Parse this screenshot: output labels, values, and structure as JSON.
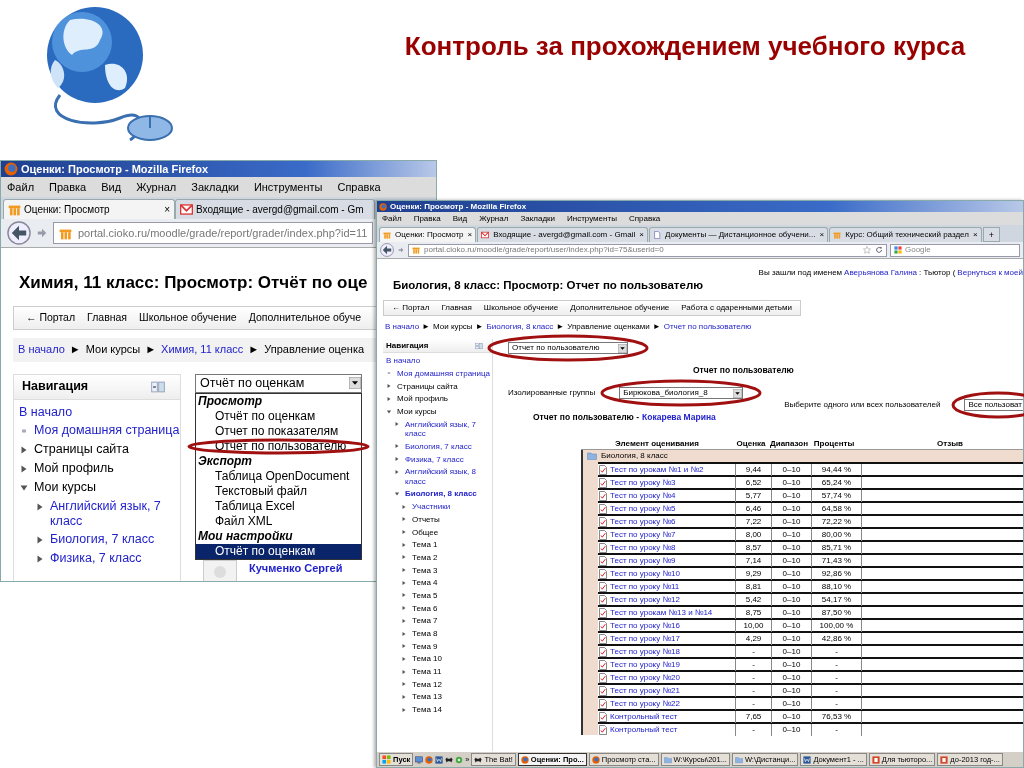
{
  "slide": {
    "title": "Контроль за прохождением учебного курса"
  },
  "window_1": {
    "title": "Оценки: Просмотр - Mozilla Firefox",
    "menu": [
      "Файл",
      "Правка",
      "Вид",
      "Журнал",
      "Закладки",
      "Инструменты",
      "Справка"
    ],
    "tabs": [
      {
        "label": "Оценки: Просмотр",
        "selected": true,
        "close": "×"
      },
      {
        "label": "Входящие - avergd@gmail.com - Gm",
        "selected": false
      }
    ],
    "address": "portal.cioko.ru/moodle/grade/report/grader/index.php?id=11",
    "heading": "Химия, 11 класс: Просмотр: Отчёт по оце",
    "nav_links": [
      "← Портал",
      "Главная",
      "Школьное обучение",
      "Дополнительное обуче"
    ],
    "breadcrumb": {
      "separator": "►",
      "items": [
        {
          "text": "В начало",
          "link": true
        },
        {
          "text": "Мои курсы",
          "link": false
        },
        {
          "text": "Химия, 11 класс",
          "link": true
        },
        {
          "text": "Управление оценка",
          "link": false
        }
      ]
    },
    "navigation": {
      "title": "Навигация",
      "items": [
        {
          "text": "В начало",
          "kind": "plain",
          "link": true
        },
        {
          "text": "Моя домашняя страница",
          "kind": "page",
          "link": true
        },
        {
          "text": "Страницы сайта",
          "kind": "node",
          "link": false,
          "expanded": false
        },
        {
          "text": "Мой профиль",
          "kind": "node",
          "link": false,
          "expanded": false
        },
        {
          "text": "Мои курсы",
          "kind": "node",
          "link": false,
          "expanded": true,
          "children": [
            {
              "text": "Английский язык, 7 класс",
              "kind": "node",
              "link": true,
              "expanded": false
            },
            {
              "text": "Биология, 7 класс",
              "kind": "node",
              "link": true,
              "expanded": false
            },
            {
              "text": "Физика, 7 класс",
              "kind": "node",
              "link": true,
              "expanded": false
            }
          ]
        }
      ]
    },
    "report_select": {
      "value": "Отчёт по оценкам"
    },
    "dropdown": [
      {
        "label": "Просмотр",
        "options": [
          {
            "label": "Отчёт по оценкам",
            "selected": false
          },
          {
            "label": "Отчет по показателям",
            "selected": false
          },
          {
            "label": "Отчет по пользователю",
            "selected": false
          }
        ]
      },
      {
        "label": "Экспорт",
        "options": [
          {
            "label": "Таблица OpenDocument",
            "selected": false
          },
          {
            "label": "Текстовый файл",
            "selected": false
          },
          {
            "label": "Таблица Excel",
            "selected": false
          },
          {
            "label": "Файл XML",
            "selected": false
          }
        ]
      },
      {
        "label": "Мои настройки",
        "options": [
          {
            "label": "Отчёт по оценкам",
            "selected": true
          }
        ]
      }
    ],
    "user_name": "Кучменко Сергей"
  },
  "window_2": {
    "title": "Оценки: Просмотр - Mozilla Firefox",
    "menu": [
      "Файл",
      "Правка",
      "Вид",
      "Журнал",
      "Закладки",
      "Инструменты",
      "Справка"
    ],
    "tabs": [
      {
        "label": "Оценки: Просмотр",
        "selected": true,
        "close": "×"
      },
      {
        "label": "Входящие - avergd@gmail.com - Gmail",
        "selected": false,
        "close": "×"
      },
      {
        "label": "Документы — Дистанционное обучени...",
        "selected": false,
        "close": "×"
      },
      {
        "label": "Курс: Общий технический раздел",
        "selected": false,
        "close": "×"
      }
    ],
    "new_tab": "+",
    "address": "portal.cioko.ru/moodle/grade/report/user/index.php?id=75&userid=0",
    "search_placeholder": "Google",
    "login": {
      "prefix": "Вы зашли под именем",
      "user": "Аверьянова Галина",
      "role": ": Тьютор (",
      "return_link": "Вернуться к моей"
    },
    "heading": "Биология, 8 класс: Просмотр: Отчет по пользователю",
    "nav_links": [
      "← Портал",
      "Главная",
      "Школьное обучение",
      "Дополнительное обучение",
      "Работа с одаренными детьми"
    ],
    "breadcrumb": {
      "separator": "►",
      "items": [
        {
          "text": "В начало",
          "link": true
        },
        {
          "text": "Мои курсы",
          "link": false
        },
        {
          "text": "Биология, 8 класс",
          "link": true
        },
        {
          "text": "Управление оценками",
          "link": false
        },
        {
          "text": "Отчет по пользователю",
          "link": true
        }
      ]
    },
    "navigation": {
      "title": "Навигация",
      "items": [
        {
          "text": "В начало",
          "kind": "plain",
          "link": true
        },
        {
          "text": "Моя домашняя страница",
          "kind": "page",
          "link": true
        },
        {
          "text": "Страницы сайта",
          "kind": "node",
          "link": false,
          "expanded": false
        },
        {
          "text": "Мой профиль",
          "kind": "node",
          "link": false,
          "expanded": false
        },
        {
          "text": "Мои курсы",
          "kind": "node",
          "link": false,
          "expanded": true,
          "children": [
            {
              "text": "Английский язык, 7 класс",
              "kind": "node",
              "link": true,
              "expanded": false,
              "current": false
            },
            {
              "text": "Биология, 7 класс",
              "kind": "node",
              "link": true,
              "expanded": false,
              "current": false
            },
            {
              "text": "Физика, 7 класс",
              "kind": "node",
              "link": true,
              "expanded": false,
              "current": false
            },
            {
              "text": "Английский язык, 8 класс",
              "kind": "node",
              "link": true,
              "expanded": false,
              "current": false
            },
            {
              "text": "Биология, 8 класс",
              "kind": "node",
              "link": true,
              "expanded": true,
              "current": true,
              "children": [
                {
                  "text": "Участники",
                  "kind": "node",
                  "link": true,
                  "expanded": false
                },
                {
                  "text": "Отчеты",
                  "kind": "node",
                  "link": false,
                  "expanded": false
                },
                {
                  "text": "Общее",
                  "kind": "node",
                  "link": false,
                  "expanded": false
                },
                {
                  "text": "Тема 1",
                  "kind": "node",
                  "link": false,
                  "expanded": false
                },
                {
                  "text": "Тема 2",
                  "kind": "node",
                  "link": false,
                  "expanded": false
                },
                {
                  "text": "Тема 3",
                  "kind": "node",
                  "link": false,
                  "expanded": false
                },
                {
                  "text": "Тема 4",
                  "kind": "node",
                  "link": false,
                  "expanded": false
                },
                {
                  "text": "Тема 5",
                  "kind": "node",
                  "link": false,
                  "expanded": false
                },
                {
                  "text": "Тема 6",
                  "kind": "node",
                  "link": false,
                  "expanded": false
                },
                {
                  "text": "Тема 7",
                  "kind": "node",
                  "link": false,
                  "expanded": false
                },
                {
                  "text": "Тема 8",
                  "kind": "node",
                  "link": false,
                  "expanded": false
                },
                {
                  "text": "Тема 9",
                  "kind": "node",
                  "link": false,
                  "expanded": false
                },
                {
                  "text": "Тема 10",
                  "kind": "node",
                  "link": false,
                  "expanded": false
                },
                {
                  "text": "Тема 11",
                  "kind": "node",
                  "link": false,
                  "expanded": false
                },
                {
                  "text": "Тема 12",
                  "kind": "node",
                  "link": false,
                  "expanded": false
                },
                {
                  "text": "Тема 13",
                  "kind": "node",
                  "link": false,
                  "expanded": false
                },
                {
                  "text": "Тема 14",
                  "kind": "node",
                  "link": false,
                  "expanded": false
                }
              ]
            }
          ]
        }
      ]
    },
    "report_select": {
      "value": "Отчет по пользователю"
    },
    "report_title": "Отчет по пользователю",
    "group_label": "Изолированные группы",
    "group_select": {
      "value": "Бирюкова_биология_8"
    },
    "users_label": "Выберите одного или всех пользователей",
    "users_select": {
      "value": "Все пользоват"
    },
    "report_user": {
      "label": "Отчет по пользователю -",
      "name": "Кокарева Марина"
    },
    "table": {
      "columns": [
        "Элемент оценивания",
        "Оценка",
        "Диапазон",
        "Проценты",
        "Отзыв"
      ],
      "category": "Биология, 8 класс",
      "rows": [
        {
          "item": "Тест по урокам №1 и №2",
          "grade": "9,44",
          "range": "0–10",
          "percent": "94,44 %"
        },
        {
          "item": "Тест по уроку №3",
          "grade": "6,52",
          "range": "0–10",
          "percent": "65,24 %"
        },
        {
          "item": "Тест по уроку №4",
          "grade": "5,77",
          "range": "0–10",
          "percent": "57,74 %"
        },
        {
          "item": "Тест по уроку №5",
          "grade": "6,46",
          "range": "0–10",
          "percent": "64,58 %"
        },
        {
          "item": "Тест по уроку №6",
          "grade": "7,22",
          "range": "0–10",
          "percent": "72,22 %"
        },
        {
          "item": "Тест по уроку №7",
          "grade": "8,00",
          "range": "0–10",
          "percent": "80,00 %"
        },
        {
          "item": "Тест по уроку №8",
          "grade": "8,57",
          "range": "0–10",
          "percent": "85,71 %"
        },
        {
          "item": "Тест по уроку №9",
          "grade": "7,14",
          "range": "0–10",
          "percent": "71,43 %"
        },
        {
          "item": "Тест по уроку №10",
          "grade": "9,29",
          "range": "0–10",
          "percent": "92,86 %"
        },
        {
          "item": "Тест по уроку №11",
          "grade": "8,81",
          "range": "0–10",
          "percent": "88,10 %"
        },
        {
          "item": "Тест по уроку №12",
          "grade": "5,42",
          "range": "0–10",
          "percent": "54,17 %"
        },
        {
          "item": "Тест по урокам №13 и №14",
          "grade": "8,75",
          "range": "0–10",
          "percent": "87,50 %"
        },
        {
          "item": "Тест по уроку №16",
          "grade": "10,00",
          "range": "0–10",
          "percent": "100,00 %"
        },
        {
          "item": "Тест по уроку №17",
          "grade": "4,29",
          "range": "0–10",
          "percent": "42,86 %"
        },
        {
          "item": "Тест по уроку №18",
          "grade": "-",
          "range": "0–10",
          "percent": "-"
        },
        {
          "item": "Тест по уроку №19",
          "grade": "-",
          "range": "0–10",
          "percent": "-"
        },
        {
          "item": "Тест по уроку №20",
          "grade": "-",
          "range": "0–10",
          "percent": "-"
        },
        {
          "item": "Тест по уроку №21",
          "grade": "-",
          "range": "0–10",
          "percent": "-"
        },
        {
          "item": "Тест по уроку №22",
          "grade": "-",
          "range": "0–10",
          "percent": "-"
        },
        {
          "item": "Контрольный тест",
          "grade": "7,65",
          "range": "0–10",
          "percent": "76,53 %"
        },
        {
          "item": "Контрольный тест",
          "grade": "-",
          "range": "0–10",
          "percent": "-"
        }
      ]
    }
  },
  "taskbar": {
    "start": "Пуск",
    "more": "»",
    "items": [
      {
        "label": "The Bat!",
        "selected": false
      },
      {
        "label": "Оценки: Про...",
        "selected": true
      },
      {
        "label": "Просмотр ста...",
        "selected": false
      },
      {
        "label": "W:\\Курсы\\201...",
        "selected": false
      },
      {
        "label": "W:\\Дистанци...",
        "selected": false
      },
      {
        "label": "Документ1 - ...",
        "selected": false
      },
      {
        "label": "Для тьюторо...",
        "selected": false
      },
      {
        "label": "до-2013 год-...",
        "selected": false
      }
    ]
  }
}
